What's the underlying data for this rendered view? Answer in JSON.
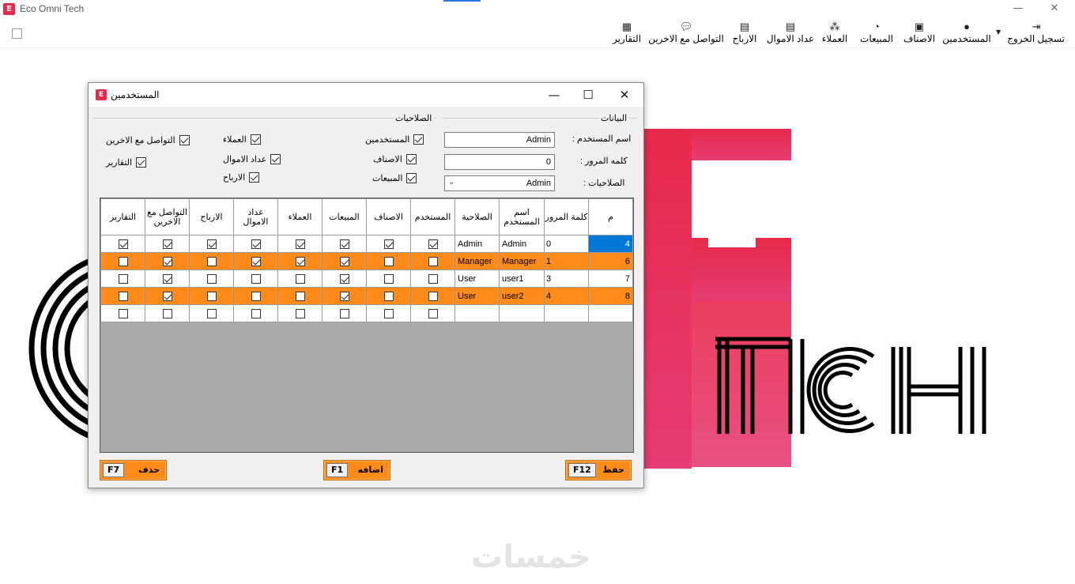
{
  "app": {
    "title": "Eco Omni Tech",
    "accent": "#e8294b"
  },
  "window_controls": {
    "minimize": "—",
    "restore": "❐",
    "close": "✕"
  },
  "toolbar": {
    "logout": "تسجيل الخروج",
    "users": "المستخدمين",
    "items": "الاصناف",
    "sales": "المبيعات",
    "customers": "العملاء",
    "counters": "عداد الاموال",
    "profits": "الارباح",
    "contact": "التواصل مع الاخرين",
    "reports": "التقارير"
  },
  "dialog": {
    "title": "المستخدمين",
    "data_group": "البيانات",
    "perm_group": "الصلاحيات",
    "username_label": "اسم المستخدم :",
    "username_value": "Admin",
    "password_label": "كلمه المرور :",
    "password_value": "0",
    "role_label": "الصلاحيات :",
    "role_value": "Admin",
    "permissions": {
      "users": "المستخدمين",
      "customers": "العملاء",
      "contact": "التواصل مع الاخرين",
      "items": "الاصناف",
      "counters": "عداد الاموال",
      "reports": "التقارير",
      "sales": "المبيعات",
      "profits": "الارباح"
    },
    "buttons": {
      "save": "حفظ",
      "save_key": "F12",
      "add": "اضافه",
      "add_key": "F1",
      "delete": "حذف",
      "delete_key": "F7"
    }
  },
  "grid": {
    "headers": {
      "idx": "م",
      "password": "كلمة المرور",
      "username": "اسم المستخدم",
      "role": "الصلاحية",
      "users": "المستخدم",
      "items": "الاصناف",
      "sales": "المبيعات",
      "customers": "العملاء",
      "counters": "عداد الاموال",
      "profits": "الارباح",
      "contact": "التواصل مع الاخرين",
      "reports": "التقارير"
    },
    "rows": [
      {
        "idx": "4",
        "password": "0",
        "username": "Admin",
        "role": "Admin"
      },
      {
        "idx": "6",
        "password": "1",
        "username": "Manager",
        "role": "Manager"
      },
      {
        "idx": "7",
        "password": "3",
        "username": "user1",
        "role": "User"
      },
      {
        "idx": "8",
        "password": "4",
        "username": "user2",
        "role": "User"
      }
    ],
    "highlight_color": "#ff8c1a"
  },
  "watermark": "خمسات"
}
